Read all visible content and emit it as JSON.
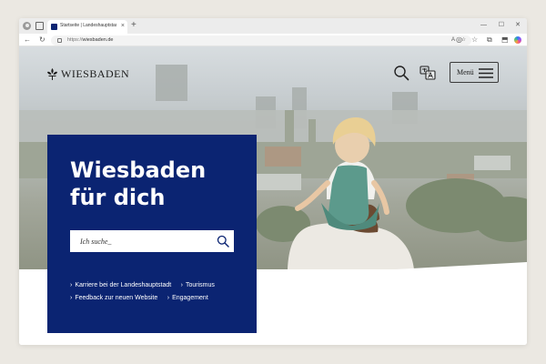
{
  "browser": {
    "tab_title": "Startseite | Landeshauptstadt Wiesbaden",
    "url_prefix": "https://",
    "url_domain": "wiesbaden.de",
    "reader_icon": "A",
    "favorite_icon": "☆",
    "new_tab": "+",
    "tab_close": "×",
    "win_min": "—",
    "win_max": "☐",
    "win_close": "✕",
    "back": "←",
    "reload": "↻",
    "ext_icons": [
      "◎",
      "☆",
      "⧉",
      "⬒"
    ],
    "tab_accent": "#0b2472"
  },
  "header": {
    "logo_text": "WIESBADEN",
    "menu_label": "Menü"
  },
  "hero": {
    "title_line1": "Wiesbaden",
    "title_line2": "für dich",
    "panel_color": "#0b2472",
    "search": {
      "placeholder": "Ich suche_"
    },
    "links": [
      "Karriere bei der Landeshauptstadt",
      "Tourismus",
      "Feedback zur neuen Website",
      "Engagement"
    ]
  }
}
